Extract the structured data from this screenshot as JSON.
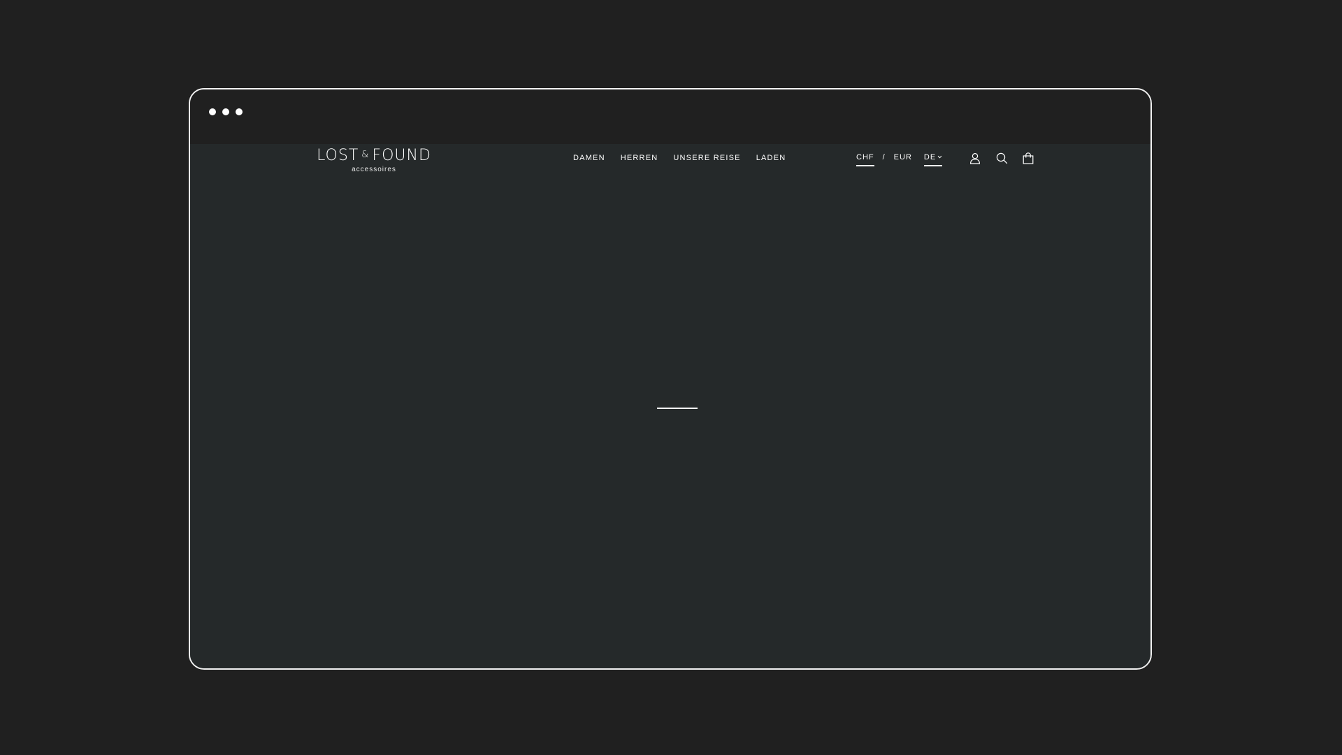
{
  "logo": {
    "name_left": "LOST",
    "ampersand": "&",
    "name_right": "FOUND",
    "subtitle": "accessoires"
  },
  "nav": {
    "items": [
      {
        "label": "DAMEN"
      },
      {
        "label": "HERREN"
      },
      {
        "label": "UNSERE REISE"
      },
      {
        "label": "LADEN"
      }
    ]
  },
  "currency": {
    "options": [
      {
        "label": "CHF",
        "selected": true
      },
      {
        "label": "EUR",
        "selected": false
      }
    ],
    "separator": "/"
  },
  "language": {
    "selected": "DE"
  },
  "icons": {
    "account": "user-icon",
    "search": "search-icon",
    "cart": "shopping-bag-icon",
    "dropdown": "chevron-down-icon"
  },
  "colors": {
    "page_background": "#202020",
    "viewport_background": "#25292a",
    "foreground": "#ffffff"
  }
}
